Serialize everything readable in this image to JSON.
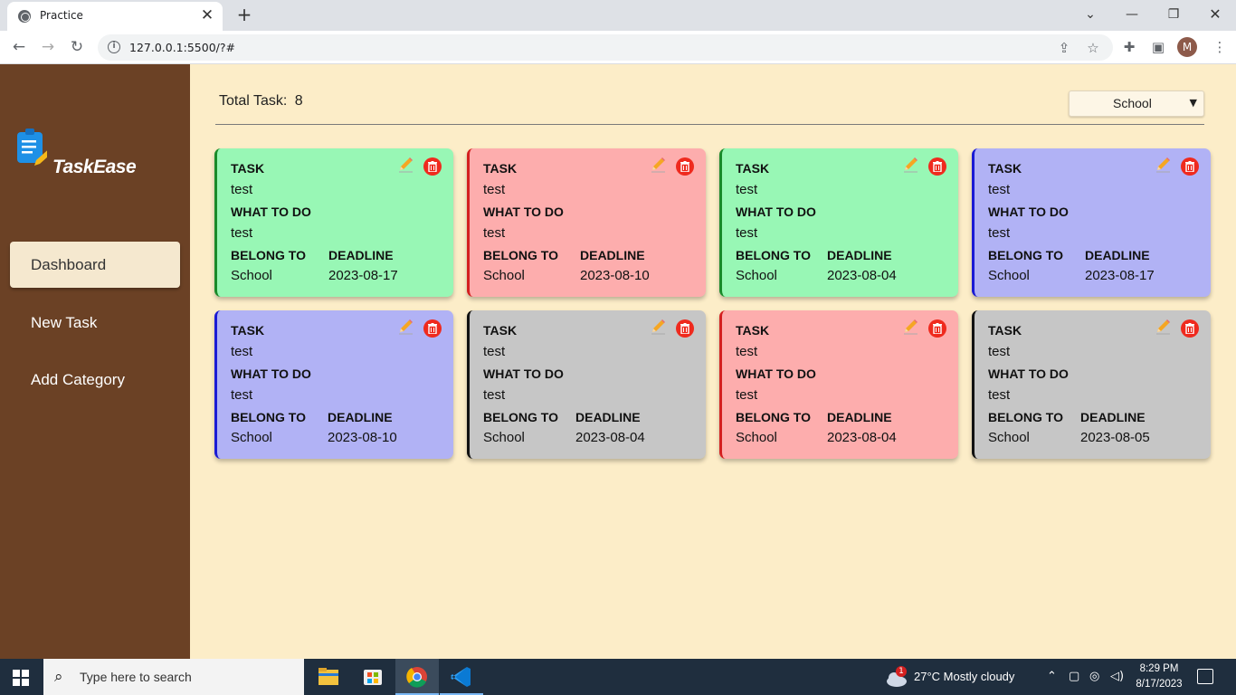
{
  "browser": {
    "tab_title": "Practice",
    "tab_close": "✕",
    "new_tab": "+",
    "url": "127.0.0.1:5500/?#",
    "profile_initial": "M"
  },
  "sidebar": {
    "logo_text": "TaskEase",
    "items": [
      {
        "label": "Dashboard",
        "active": true
      },
      {
        "label": "New Task",
        "active": false
      },
      {
        "label": "Add Category",
        "active": false
      }
    ]
  },
  "main": {
    "total_label": "Total Task:",
    "total_count": "8",
    "category_select": "School"
  },
  "card_labels": {
    "task": "TASK",
    "what": "WHAT TO DO",
    "belong": "BELONG TO",
    "deadline": "DEADLINE"
  },
  "cards": [
    {
      "task": "test",
      "what": "test",
      "belong": "School",
      "deadline": "2023-08-17",
      "color": "#98f7b5",
      "border": "#1a8a2a"
    },
    {
      "task": "test",
      "what": "test",
      "belong": "School",
      "deadline": "2023-08-10",
      "color": "#fdadad",
      "border": "#d42020"
    },
    {
      "task": "test",
      "what": "test",
      "belong": "School",
      "deadline": "2023-08-04",
      "color": "#98f7b5",
      "border": "#1a8a2a"
    },
    {
      "task": "test",
      "what": "test",
      "belong": "School",
      "deadline": "2023-08-17",
      "color": "#b1b2f5",
      "border": "#1a1ad4"
    },
    {
      "task": "test",
      "what": "test",
      "belong": "School",
      "deadline": "2023-08-10",
      "color": "#b1b2f5",
      "border": "#1a1ad4"
    },
    {
      "task": "test",
      "what": "test",
      "belong": "School",
      "deadline": "2023-08-04",
      "color": "#c6c6c6",
      "border": "#111111"
    },
    {
      "task": "test",
      "what": "test",
      "belong": "School",
      "deadline": "2023-08-04",
      "color": "#fdadad",
      "border": "#d42020"
    },
    {
      "task": "test",
      "what": "test",
      "belong": "School",
      "deadline": "2023-08-05",
      "color": "#c6c6c6",
      "border": "#111111"
    }
  ],
  "taskbar": {
    "search_placeholder": "Type here to search",
    "weather": "27°C  Mostly cloudy",
    "weather_badge": "1",
    "time": "8:29 PM",
    "date": "8/17/2023"
  }
}
